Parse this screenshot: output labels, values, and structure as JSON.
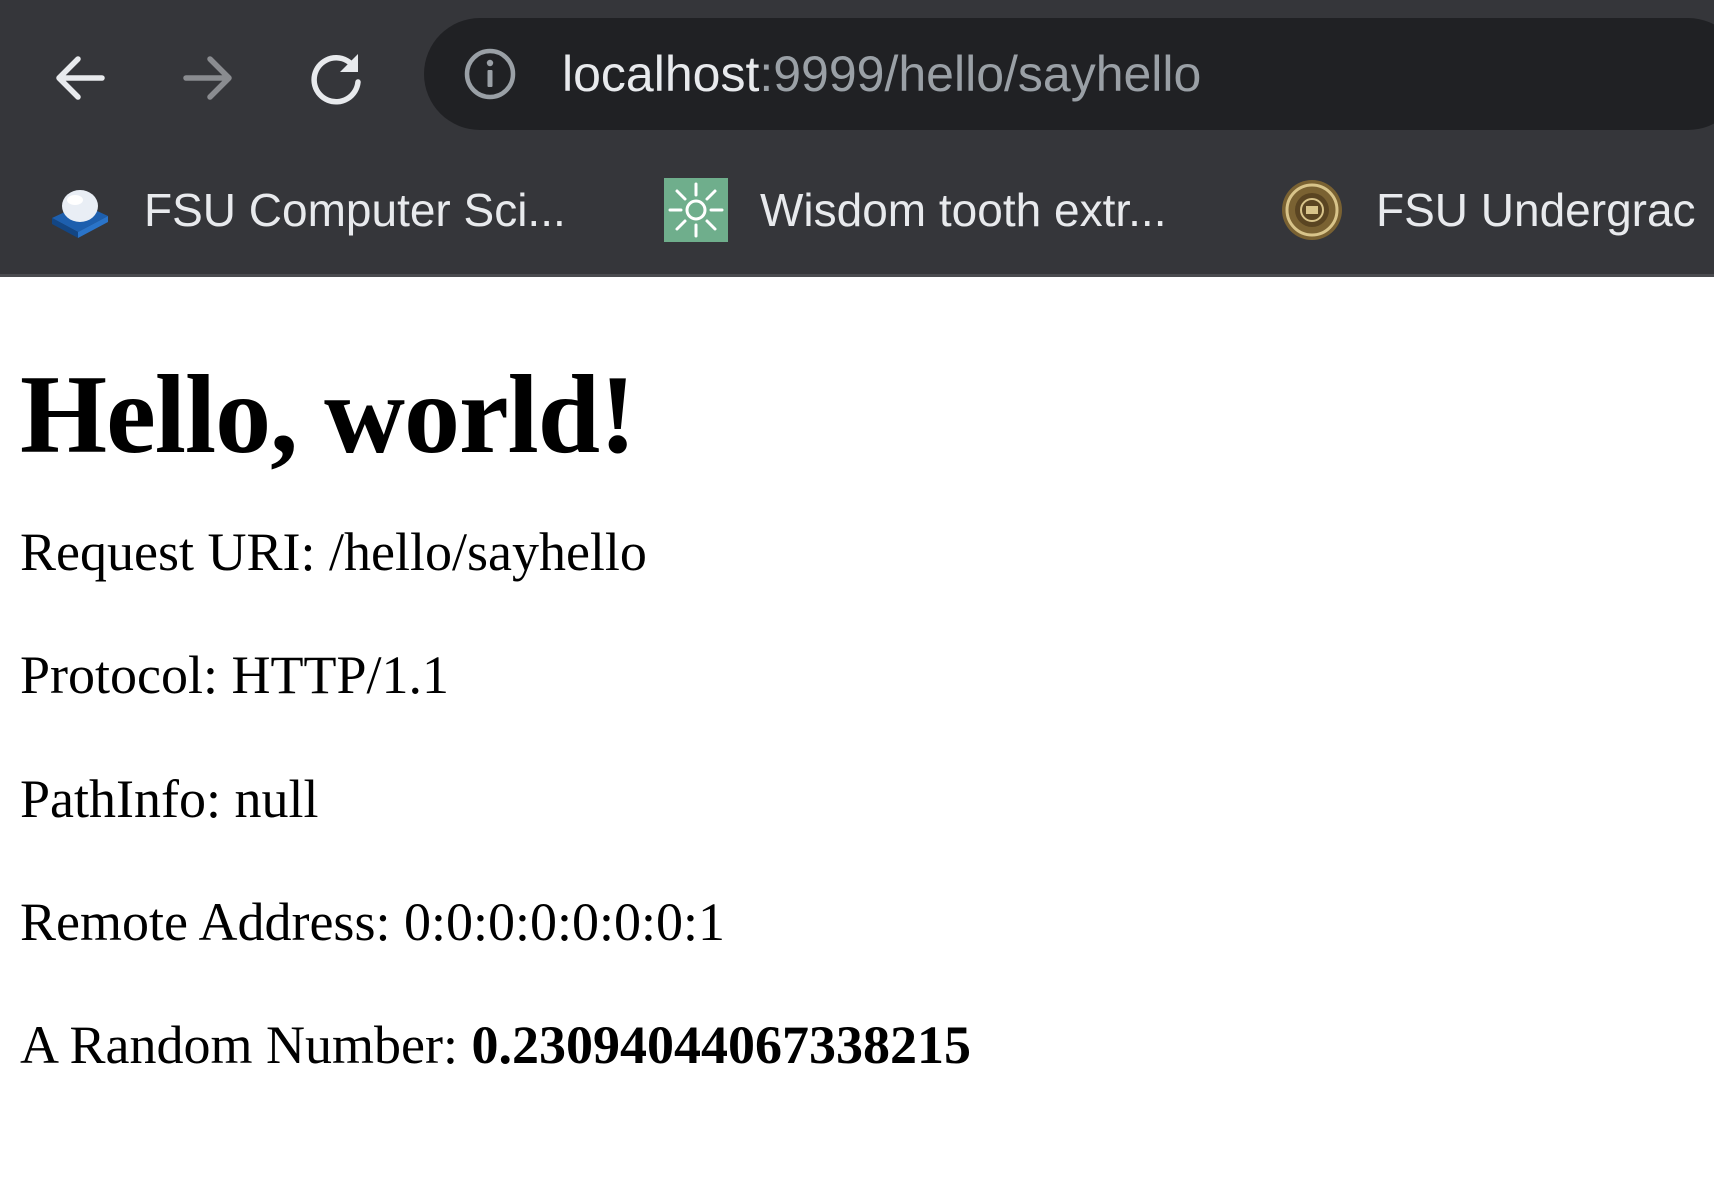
{
  "browser": {
    "url_host": "localhost",
    "url_rest": ":9999/hello/sayhello",
    "icons": {
      "back": "arrow-left-icon",
      "forward": "arrow-right-icon",
      "reload": "reload-icon",
      "site_info": "info-icon"
    },
    "colors": {
      "chrome_bg": "#35363a",
      "omnibox_bg": "#202124",
      "url_host": "#e8eaed",
      "url_rest": "#9aa0a6"
    }
  },
  "bookmarks": [
    {
      "label": "FSU Computer Sci...",
      "icon": "blue-cube-icon"
    },
    {
      "label": "Wisdom tooth extr...",
      "icon": "green-sunburst-icon"
    },
    {
      "label": "FSU Undergrac",
      "icon": "seal-icon"
    }
  ],
  "page": {
    "heading": "Hello, world!",
    "lines": [
      {
        "label": "Request URI: ",
        "value": "/hello/sayhello"
      },
      {
        "label": "Protocol: ",
        "value": "HTTP/1.1"
      },
      {
        "label": "PathInfo: ",
        "value": "null"
      },
      {
        "label": "Remote Address: ",
        "value": "0:0:0:0:0:0:0:1"
      },
      {
        "label": "A Random Number: ",
        "value": "0.23094044067338215"
      }
    ]
  }
}
